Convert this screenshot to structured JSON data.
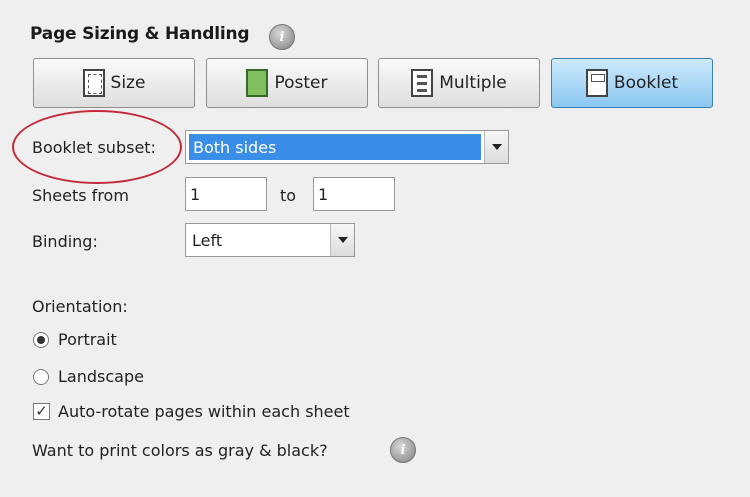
{
  "section": {
    "title": "Page Sizing & Handling"
  },
  "modes": {
    "size_label": "Size",
    "poster_label": "Poster",
    "multiple_label": "Multiple",
    "booklet_label": "Booklet"
  },
  "booklet_subset": {
    "label": "Booklet subset:",
    "value": "Both sides"
  },
  "sheets": {
    "label": "Sheets from",
    "from_value": "1",
    "to_label": "to",
    "to_value": "1"
  },
  "binding": {
    "label": "Binding:",
    "value": "Left"
  },
  "orientation": {
    "label": "Orientation:",
    "portrait_label": "Portrait",
    "landscape_label": "Landscape",
    "selected": "Portrait"
  },
  "auto_rotate": {
    "label": "Auto-rotate pages within each sheet",
    "checked": true,
    "check_glyph": "✓"
  },
  "gray_print": {
    "question": "Want to print colors as gray & black?"
  },
  "info_glyph": "i",
  "colors": {
    "active_button": "#8cc8f1",
    "selection_highlight": "#3a8ee8",
    "annotation_ellipse": "#c22a3a"
  }
}
